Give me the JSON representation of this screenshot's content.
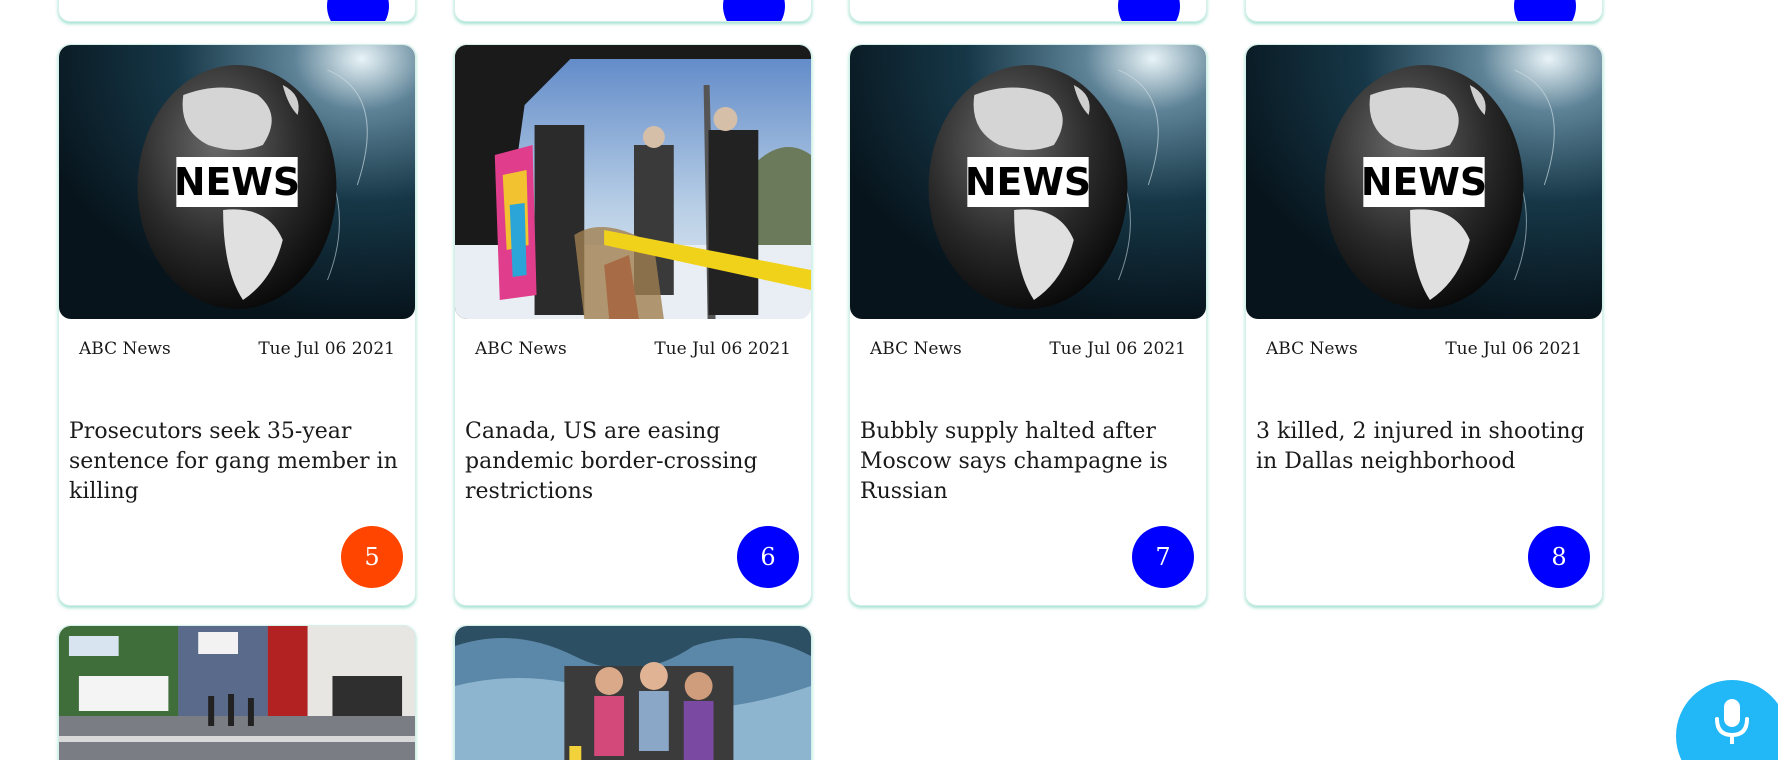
{
  "colors": {
    "badge_highlight": "#ff4500",
    "badge_default": "#0000ff",
    "mic_button": "#22b8f7",
    "card_shadow": "#5ecfb0"
  },
  "cards": [
    {
      "source": "ABC News",
      "date": "Tue Jul 06 2021",
      "title": "Prosecutors seek 35-year sentence for gang member in killing",
      "number": "5",
      "badge_color": "#ff4500",
      "image": "news-globe"
    },
    {
      "source": "ABC News",
      "date": "Tue Jul 06 2021",
      "title": "Canada, US are easing pandemic border-crossing restrictions",
      "number": "6",
      "badge_color": "#0000ff",
      "image": "border-crossing-photo"
    },
    {
      "source": "ABC News",
      "date": "Tue Jul 06 2021",
      "title": "Bubbly supply halted after Moscow says champagne is Russian",
      "number": "7",
      "badge_color": "#0000ff",
      "image": "news-globe"
    },
    {
      "source": "ABC News",
      "date": "Tue Jul 06 2021",
      "title": "3 killed, 2 injured in shooting in Dallas neighborhood",
      "number": "8",
      "badge_color": "#0000ff",
      "image": "news-globe"
    }
  ],
  "globe_label": "NEWS",
  "mic_icon": "microphone-icon"
}
